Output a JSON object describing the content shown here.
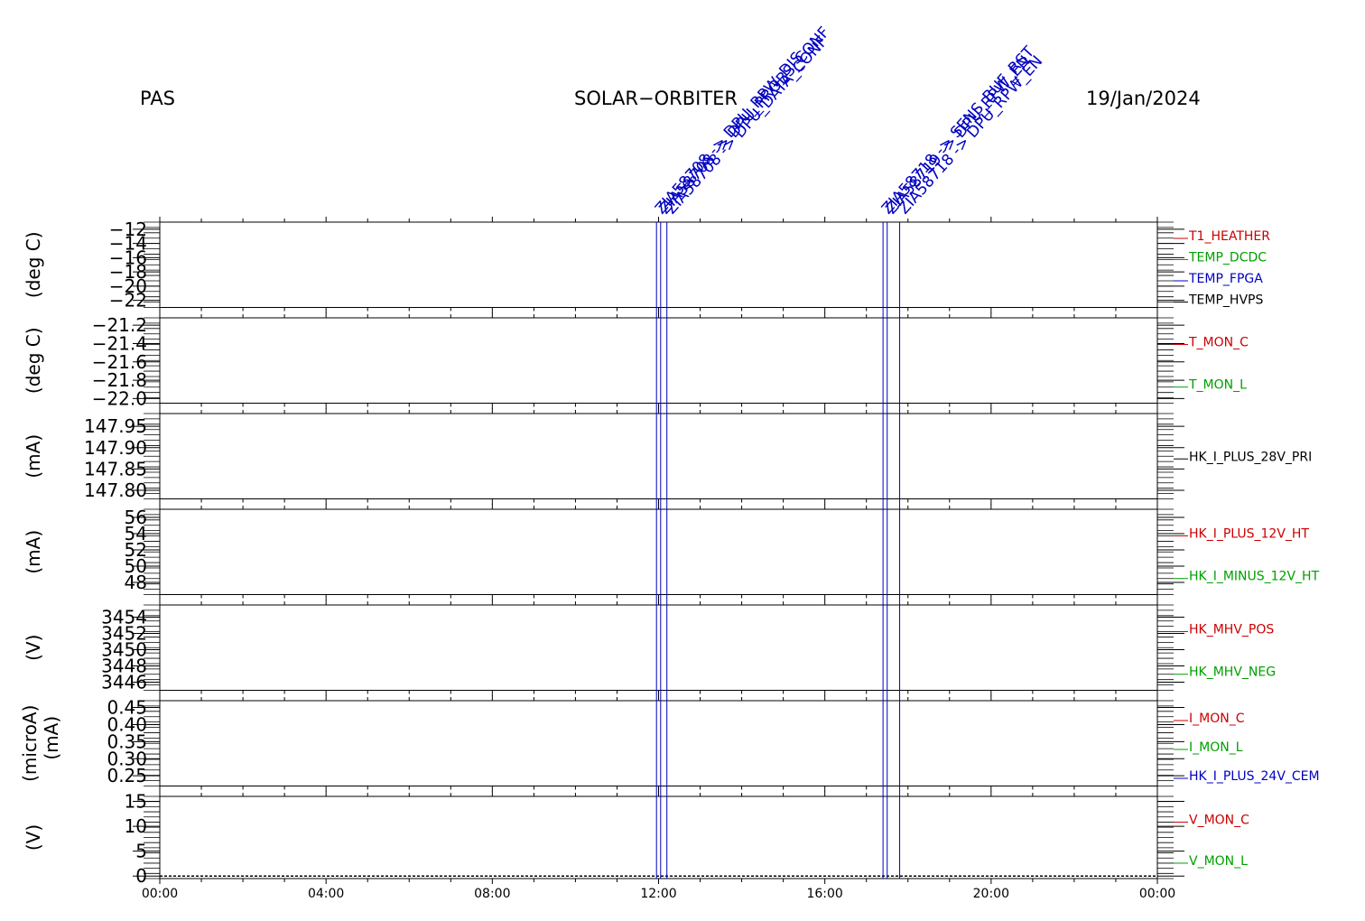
{
  "header": {
    "instrument": "PAS",
    "mission": "SOLAR−ORBITER",
    "date": "19/Jan/2024"
  },
  "colors": {
    "axis": "#000000",
    "event": "#0000c0",
    "red": "#cc0000",
    "green": "#00a000",
    "blue": "#0000c0",
    "black": "#000000"
  },
  "chart_data": {
    "type": "line",
    "x_range": [
      "00:00",
      "24:00"
    ],
    "x_ticks": [
      "00:00",
      "04:00",
      "08:00",
      "12:00",
      "16:00",
      "20:00",
      "00:00"
    ],
    "events": [
      {
        "time_h": 11.95,
        "labels": [
          "ZIA58708 -> DPU_RPW_DIS"
        ]
      },
      {
        "time_h": 12.05,
        "labels": [
          "ZIA58708 -> DPU_PROBS_CONF"
        ]
      },
      {
        "time_h": 12.2,
        "labels": [
          "ZIA58708 -> DPU_DATA_CONF"
        ]
      },
      {
        "time_h": 17.4,
        "labels": [
          "ZIA58718 -> SENS_BUF_RST"
        ]
      },
      {
        "time_h": 17.5,
        "labels": [
          "ZIA58719 -> DPU_RPW_EN"
        ]
      },
      {
        "time_h": 17.8,
        "labels": [
          "ZIA58718 -> DPU_RPW_EN"
        ]
      }
    ],
    "panels": [
      {
        "unit": "(deg C)",
        "ylim": [
          -23,
          -11
        ],
        "ticks": [
          -12,
          -14,
          -16,
          -18,
          -20,
          -22
        ],
        "tick_labels": [
          "−12",
          "−14",
          "−16",
          "−18",
          "−20",
          "−22"
        ],
        "series": [
          {
            "name": "T1_HEATHER",
            "color": "red"
          },
          {
            "name": "TEMP_DCDC",
            "color": "green"
          },
          {
            "name": "TEMP_FPGA",
            "color": "blue"
          },
          {
            "name": "TEMP_HVPS",
            "color": "black"
          }
        ]
      },
      {
        "unit": "(deg C)",
        "ylim": [
          -22.05,
          -21.12
        ],
        "ticks": [
          -21.2,
          -21.4,
          -21.6,
          -21.8,
          -22.0
        ],
        "tick_labels": [
          "−21.2",
          "−21.4",
          "−21.6",
          "−21.8",
          "−22.0"
        ],
        "series": [
          {
            "name": "T_MON_C",
            "color": "red"
          },
          {
            "name": "T_MON_L",
            "color": "green"
          }
        ]
      },
      {
        "unit": "(mA)",
        "ylim": [
          147.78,
          147.98
        ],
        "ticks": [
          147.95,
          147.9,
          147.85,
          147.8
        ],
        "tick_labels": [
          "147.95",
          "147.90",
          "147.85",
          "147.80"
        ],
        "series": [
          {
            "name": "HK_I_PLUS_28V_PRI",
            "color": "black"
          }
        ]
      },
      {
        "unit": "(mA)",
        "ylim": [
          46.5,
          57
        ],
        "ticks": [
          56,
          54,
          52,
          50,
          48
        ],
        "tick_labels": [
          "56",
          "54",
          "52",
          "50",
          "48"
        ],
        "series": [
          {
            "name": "HK_I_PLUS_12V_HT",
            "color": "red"
          },
          {
            "name": "HK_I_MINUS_12V_HT",
            "color": "green"
          }
        ]
      },
      {
        "unit": "(V)",
        "ylim": [
          3445,
          3455.5
        ],
        "ticks": [
          3454,
          3452,
          3450,
          3448,
          3446
        ],
        "tick_labels": [
          "3454",
          "3452",
          "3450",
          "3448",
          "3446"
        ],
        "series": [
          {
            "name": "HK_MHV_POS",
            "color": "red"
          },
          {
            "name": "HK_MHV_NEG",
            "color": "green"
          }
        ]
      },
      {
        "unit": "(microA)",
        "unit2": "(mA)",
        "ylim": [
          0.22,
          0.47
        ],
        "ticks": [
          0.45,
          0.4,
          0.35,
          0.3,
          0.25
        ],
        "tick_labels": [
          "0.45",
          "0.40",
          "0.35",
          "0.30",
          "0.25"
        ],
        "series": [
          {
            "name": "I_MON_C",
            "color": "red"
          },
          {
            "name": "I_MON_L",
            "color": "green"
          },
          {
            "name": "HK_I_PLUS_24V_CEM",
            "color": "blue"
          }
        ]
      },
      {
        "unit": "(V)",
        "ylim": [
          -0.5,
          16
        ],
        "ticks": [
          15,
          10,
          5,
          0
        ],
        "tick_labels": [
          "15",
          "10",
          "5",
          "0"
        ],
        "series": [
          {
            "name": "V_MON_C",
            "color": "red",
            "values": [
              0,
              0
            ]
          },
          {
            "name": "V_MON_L",
            "color": "green",
            "values": [
              0,
              0
            ]
          }
        ]
      }
    ]
  }
}
